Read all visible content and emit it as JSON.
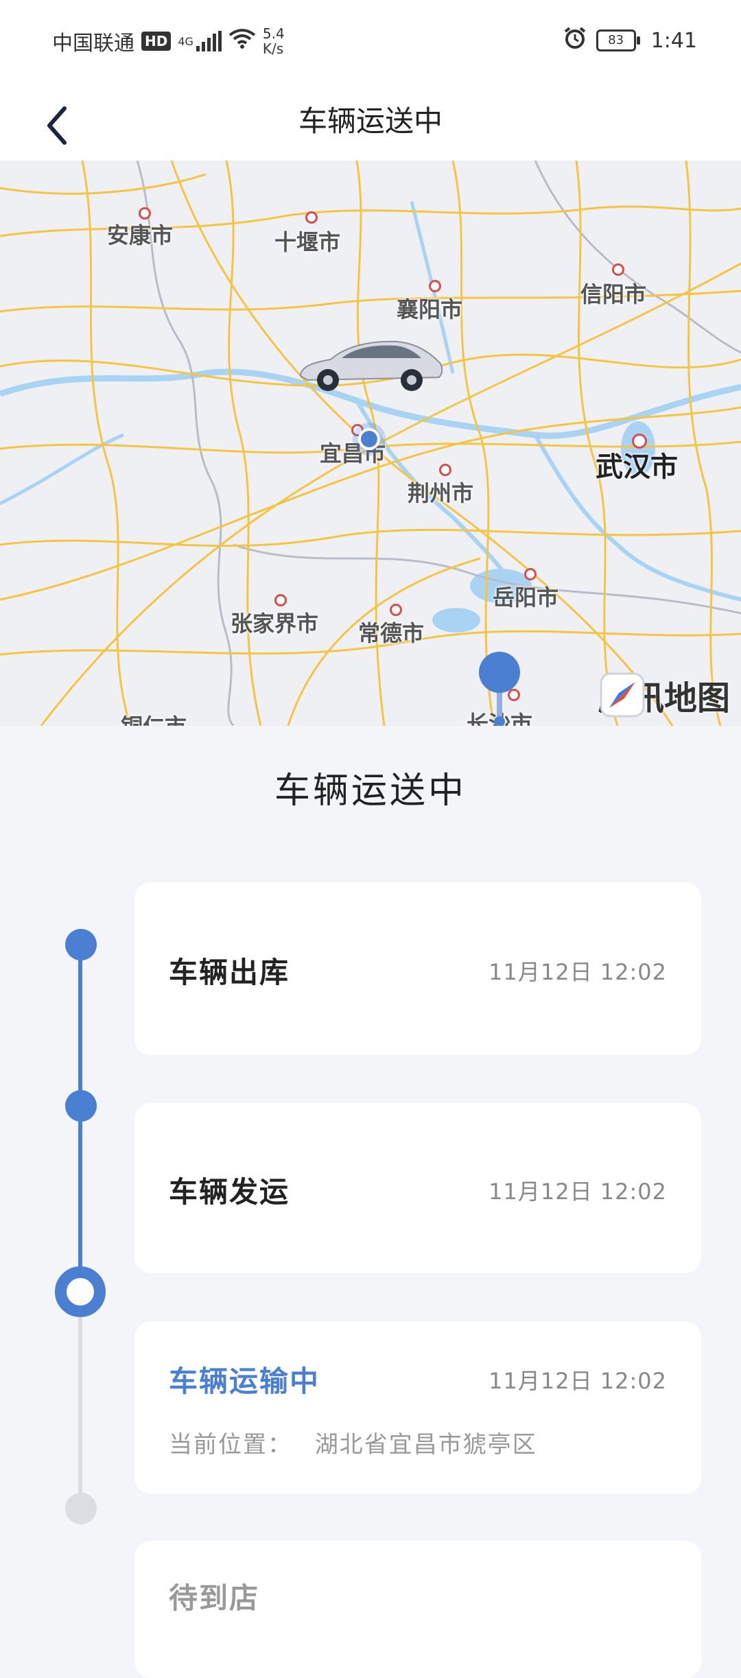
{
  "status_bar": {
    "carrier": "中国联通",
    "hd": "HD",
    "network": "4G",
    "speed_value": "5.4",
    "speed_unit": "K/s",
    "battery": "83",
    "time": "1:41"
  },
  "header": {
    "title": "车辆运送中"
  },
  "map": {
    "cities": {
      "ankang": "安康市",
      "shiyan": "十堰市",
      "xiangyang": "襄阳市",
      "xinyang": "信阳市",
      "yichang": "宜昌市",
      "jingzhou": "荆州市",
      "wuhan": "武汉市",
      "yueyang": "岳阳市",
      "zhangjiajie": "张家界市",
      "changde": "常德市",
      "tongren": "铜仁市",
      "changsha": "长沙市"
    },
    "watermark": "腾讯地图"
  },
  "section_title": "车辆运送中",
  "timeline": {
    "steps": [
      {
        "title": "车辆出库",
        "time": "11月12日 12:02"
      },
      {
        "title": "车辆发运",
        "time": "11月12日 12:02"
      },
      {
        "title": "车辆运输中",
        "time": "11月12日 12:02",
        "location_label": "当前位置：",
        "location_value": "湖北省宜昌市猇亭区"
      },
      {
        "title": "待到店"
      }
    ]
  },
  "colors": {
    "accent": "#4a7fd2",
    "inactive": "#dcdde2",
    "road": "#f5c542",
    "water": "#a9d3f2",
    "border": "#b8bcc6"
  }
}
